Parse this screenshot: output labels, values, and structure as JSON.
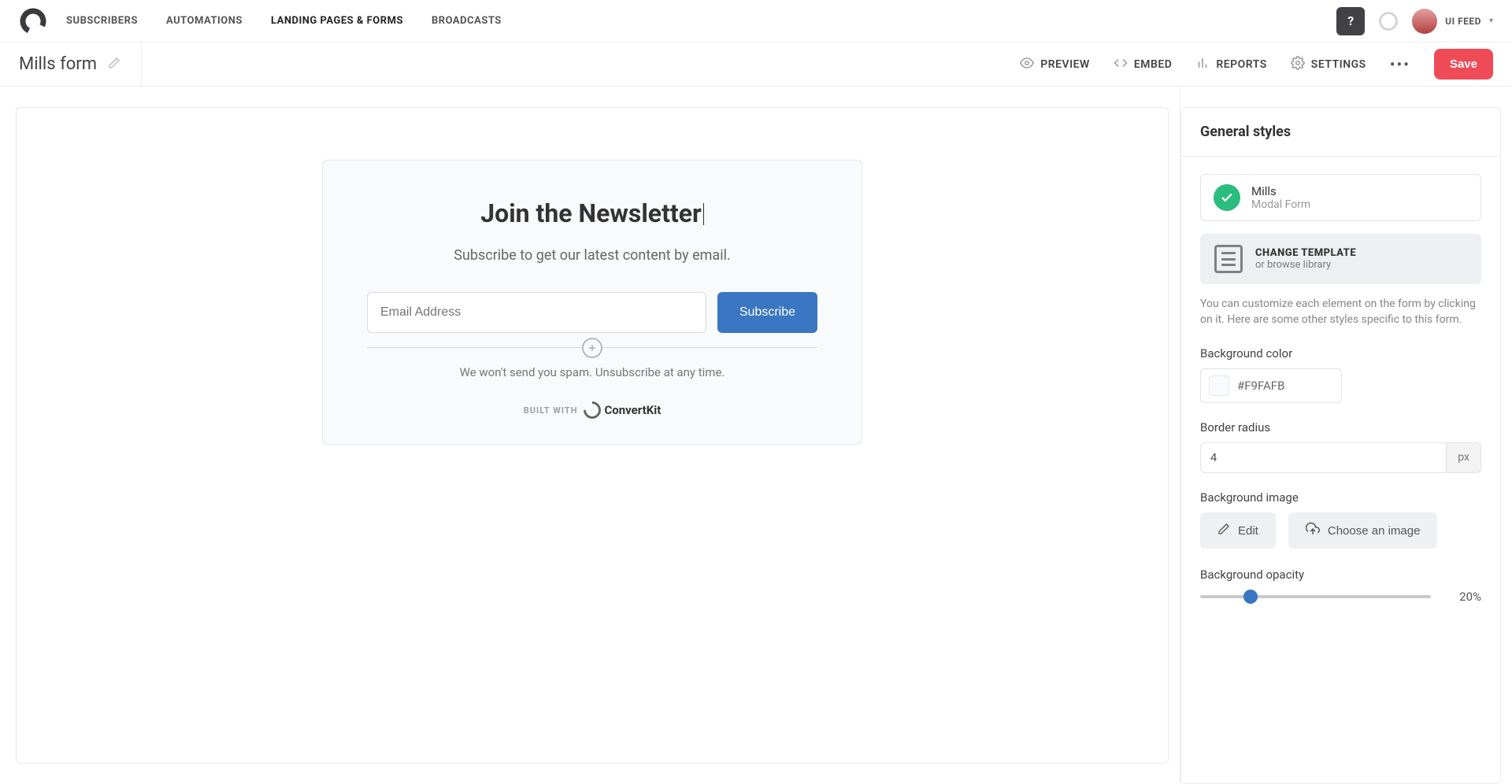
{
  "topnav": {
    "items": [
      "SUBSCRIBERS",
      "AUTOMATIONS",
      "LANDING PAGES & FORMS",
      "BROADCASTS"
    ],
    "help": "?",
    "user_label": "UI FEED"
  },
  "subbar": {
    "form_name": "Mills form",
    "links": {
      "preview": "PREVIEW",
      "embed": "EMBED",
      "reports": "REPORTS",
      "settings": "SETTINGS"
    },
    "save": "Save"
  },
  "form": {
    "title": "Join the Newsletter",
    "subtitle": "Subscribe to get our latest content by email.",
    "email_placeholder": "Email Address",
    "subscribe": "Subscribe",
    "disclaimer": "We won't send you spam. Unsubscribe at any time.",
    "built_with": "BUILT WITH",
    "brand": "ConvertKit"
  },
  "sidebar": {
    "heading": "General styles",
    "template": {
      "name": "Mills",
      "type": "Modal Form"
    },
    "change": {
      "title": "CHANGE TEMPLATE",
      "sub": "or browse library"
    },
    "hint": "You can customize each element on the form by clicking on it. Here are some other styles specific to this form.",
    "bgcolor": {
      "label": "Background color",
      "value": "#F9FAFB"
    },
    "radius": {
      "label": "Border radius",
      "value": "4",
      "unit": "px"
    },
    "bgimage": {
      "label": "Background image",
      "edit": "Edit",
      "choose": "Choose an image"
    },
    "opacity": {
      "label": "Background opacity",
      "value": 20,
      "display": "20%"
    }
  }
}
